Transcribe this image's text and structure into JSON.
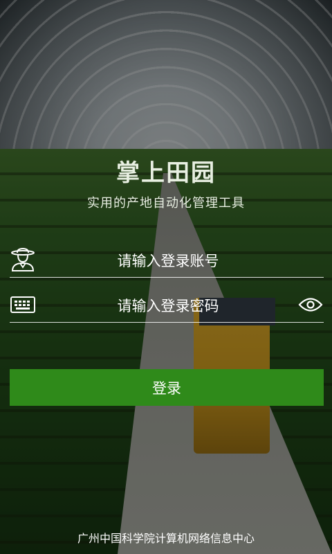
{
  "app": {
    "title": "掌上田园",
    "subtitle": "实用的产地自动化管理工具"
  },
  "login": {
    "username_placeholder": "请输入登录账号",
    "password_placeholder": "请输入登录密码",
    "submit_label": "登录"
  },
  "footer": {
    "text": "广州中国科学院计算机网络信息中心"
  },
  "icons": {
    "user": "farmer-user-icon",
    "password": "keyboard-icon",
    "show_password": "eye-icon"
  },
  "colors": {
    "accent": "#2f8a1a",
    "text": "#ffffff"
  }
}
